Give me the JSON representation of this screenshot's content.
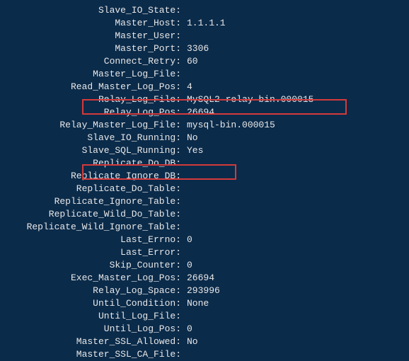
{
  "rows": [
    {
      "label": "Slave_IO_State:",
      "value": ""
    },
    {
      "label": "Master_Host:",
      "value": "1.1.1.1"
    },
    {
      "label": "Master_User:",
      "value": ""
    },
    {
      "label": "Master_Port:",
      "value": "3306"
    },
    {
      "label": "Connect_Retry:",
      "value": "60"
    },
    {
      "label": "Master_Log_File:",
      "value": ""
    },
    {
      "label": "Read_Master_Log_Pos:",
      "value": "4"
    },
    {
      "label": "Relay_Log_File:",
      "value": "MySQL2-relay-bin.000015"
    },
    {
      "label": "Relay_Log_Pos:",
      "value": "26694"
    },
    {
      "label": "Relay_Master_Log_File:",
      "value": "mysql-bin.000015"
    },
    {
      "label": "Slave_IO_Running:",
      "value": "No"
    },
    {
      "label": "Slave_SQL_Running:",
      "value": "Yes"
    },
    {
      "label": "Replicate_Do_DB:",
      "value": ""
    },
    {
      "label": "Replicate_Ignore_DB:",
      "value": ""
    },
    {
      "label": "Replicate_Do_Table:",
      "value": ""
    },
    {
      "label": "Replicate_Ignore_Table:",
      "value": ""
    },
    {
      "label": "Replicate_Wild_Do_Table:",
      "value": ""
    },
    {
      "label": "Replicate_Wild_Ignore_Table:",
      "value": ""
    },
    {
      "label": "Last_Errno:",
      "value": "0"
    },
    {
      "label": "Last_Error:",
      "value": ""
    },
    {
      "label": "Skip_Counter:",
      "value": "0"
    },
    {
      "label": "Exec_Master_Log_Pos:",
      "value": "26694"
    },
    {
      "label": "Relay_Log_Space:",
      "value": "293996"
    },
    {
      "label": "Until_Condition:",
      "value": "None"
    },
    {
      "label": "Until_Log_File:",
      "value": ""
    },
    {
      "label": "Until_Log_Pos:",
      "value": "0"
    },
    {
      "label": "Master_SSL_Allowed:",
      "value": "No"
    },
    {
      "label": "Master_SSL_CA_File:",
      "value": ""
    }
  ],
  "highlights": {
    "box1_color": "#d43a3a",
    "box2_color": "#d43a3a"
  }
}
